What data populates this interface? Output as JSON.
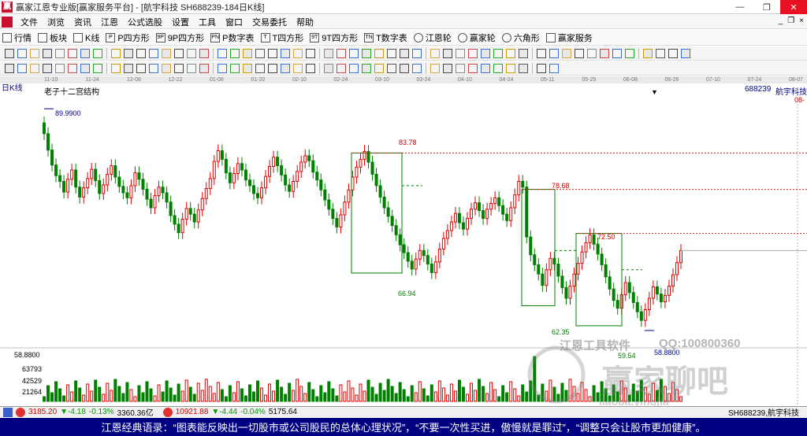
{
  "window": {
    "title": "赢家江恩专业版[赢家服务平台] - [航宇科技  SH688239-184日K线]",
    "controls": {
      "minimize": "—",
      "restore": "❐",
      "close": "✕"
    }
  },
  "menu": {
    "items": [
      "文件",
      "浏览",
      "资讯",
      "江恩",
      "公式选股",
      "设置",
      "工具",
      "窗口",
      "交易委托",
      "帮助"
    ],
    "right_controls": [
      "_",
      "❐",
      "×"
    ]
  },
  "toolbar": {
    "items": [
      {
        "label": "行情",
        "icon": "grid-icon"
      },
      {
        "label": "板块",
        "icon": "blocks-icon"
      },
      {
        "label": "K线",
        "icon": "kline-icon"
      },
      {
        "label": "P四方形",
        "icon": "P"
      },
      {
        "label": "9P四方形",
        "icon": "9P"
      },
      {
        "label": "P数字表",
        "icon": "PN"
      },
      {
        "label": "T四方形",
        "icon": "T"
      },
      {
        "label": "9T四方形",
        "icon": "9T"
      },
      {
        "label": "T数字表",
        "icon": "TN"
      },
      {
        "label": "江恩轮",
        "icon": "wheel-icon"
      },
      {
        "label": "赢家轮",
        "icon": "wheel-icon"
      },
      {
        "label": "六角形",
        "icon": "hexagon-icon"
      },
      {
        "label": "赢家服务",
        "icon": "service-icon"
      }
    ]
  },
  "date_axis": [
    "11-10",
    "11-24",
    "12-08",
    "12-22",
    "01-06",
    "01-20",
    "02-10",
    "02-24",
    "03-10",
    "03-24",
    "04-10",
    "04-24",
    "05-11",
    "05-25",
    "06-08",
    "06-26",
    "07-10",
    "07-24",
    "08-07"
  ],
  "chart_header": {
    "period": "日K线",
    "indicator": "老子十二宫结构",
    "stock_code": "688239",
    "stock_name": "航宇科技",
    "right_clip": "08-",
    "dropdown_arrow": "▼"
  },
  "price_labels": {
    "high": "89.9900",
    "box1_top": "83.78",
    "box1_bottom": "66.94",
    "box2_top": "78.68",
    "box2_bottom": "62.35",
    "box3_top": "72.50",
    "box3_bottom": "59.54",
    "low": "58.8800"
  },
  "volume_axis": {
    "ticks": [
      "58.8800",
      "63793",
      "42529",
      "21264"
    ]
  },
  "watermark": {
    "line1": "江恩工具软件",
    "line2": "QQ:100800360",
    "brand": "赢家聊吧",
    "url": "liaoba.yingjia"
  },
  "status": {
    "index1": {
      "price": "3185.20",
      "change": "▼-4.18",
      "pct": "-0.13%",
      "amount": "3360.36亿"
    },
    "index2": {
      "price": "10921.88",
      "change": "▼-4.44",
      "pct": "-0.04%",
      "amount": "5175.64"
    },
    "right": "SH688239,航宇科技"
  },
  "quote": "江恩经典语录：“图表能反映出一切股市或公司股民的总体心理状况”，“不要一次性买进，傲慢就是罪过”，“调整只会让股市更加健康”。",
  "chart_data": {
    "type": "candlestick",
    "title": "老子十二宫结构",
    "ylim": [
      56,
      92
    ],
    "up_color": "#e00000",
    "down_color": "#008000",
    "annotations": [
      {
        "label": "83.78",
        "value": 83.78
      },
      {
        "label": "66.94",
        "value": 66.94
      },
      {
        "label": "78.68",
        "value": 78.68
      },
      {
        "label": "62.35",
        "value": 62.35
      },
      {
        "label": "72.50",
        "value": 72.5
      },
      {
        "label": "59.54",
        "value": 59.54
      }
    ],
    "closes": [
      86.5,
      84.2,
      82.1,
      80.6,
      79.8,
      78.3,
      80.1,
      81.4,
      79.0,
      77.6,
      78.9,
      80.2,
      81.5,
      79.9,
      78.1,
      79.3,
      80.8,
      82.0,
      80.4,
      79.1,
      78.2,
      77.5,
      79.2,
      81.0,
      80.1,
      78.7,
      77.3,
      76.1,
      77.8,
      79.0,
      78.2,
      76.9,
      75.0,
      73.8,
      72.6,
      74.5,
      76.0,
      75.2,
      74.1,
      75.8,
      77.4,
      78.8,
      80.2,
      82.6,
      84.1,
      82.9,
      81.0,
      79.6,
      80.9,
      82.3,
      81.4,
      80.0,
      79.2,
      78.1,
      77.5,
      78.9,
      80.5,
      81.9,
      83.2,
      82.0,
      80.7,
      79.3,
      78.4,
      79.8,
      81.2,
      82.5,
      83.4,
      82.7,
      81.1,
      80.0,
      78.6,
      77.2,
      75.9,
      74.6,
      73.4,
      75.1,
      76.9,
      78.6,
      80.4,
      81.8,
      82.9,
      84.0,
      82.5,
      80.8,
      79.2,
      77.6,
      76.1,
      74.9,
      73.6,
      72.3,
      70.9,
      69.8,
      68.6,
      67.5,
      68.9,
      70.1,
      69.4,
      68.2,
      67.0,
      68.5,
      70.3,
      71.8,
      72.9,
      74.1,
      75.3,
      74.0,
      73.1,
      74.6,
      75.9,
      76.8,
      75.7,
      74.6,
      75.9,
      76.7,
      77.5,
      76.4,
      75.2,
      74.3,
      76.1,
      77.9,
      79.8,
      79.0,
      72.0,
      69.5,
      68.1,
      66.8,
      65.2,
      67.4,
      69.0,
      68.2,
      66.5,
      64.9,
      63.4,
      65.1,
      66.8,
      68.3,
      69.9,
      71.2,
      72.3,
      71.0,
      69.6,
      68.1,
      66.4,
      64.7,
      63.1,
      62.0,
      63.9,
      65.6,
      64.2,
      62.8,
      61.5,
      60.3,
      61.8,
      63.4,
      65.0,
      64.0,
      62.9,
      63.8,
      65.1,
      66.7,
      68.4,
      70.1
    ]
  }
}
